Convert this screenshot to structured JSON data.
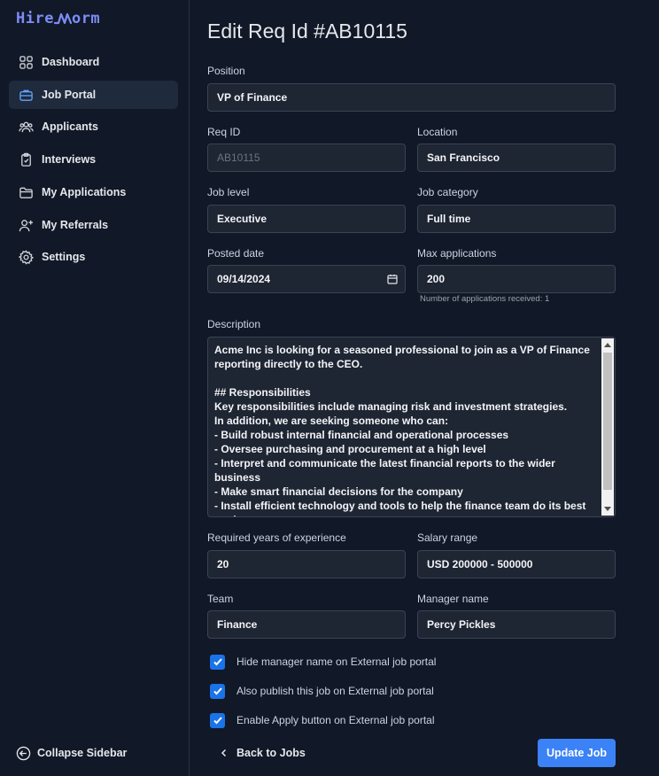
{
  "app": {
    "logo_text_left": "Hire",
    "logo_text_right": "orm",
    "accent_color": "#3b82f6",
    "logo_color": "#7c8cf8"
  },
  "sidebar": {
    "items": [
      {
        "label": "Dashboard",
        "icon": "grid-icon"
      },
      {
        "label": "Job Portal",
        "icon": "briefcase-icon",
        "active": true
      },
      {
        "label": "Applicants",
        "icon": "users-icon"
      },
      {
        "label": "Interviews",
        "icon": "clipboard-icon"
      },
      {
        "label": "My Applications",
        "icon": "folder-icon"
      },
      {
        "label": "My Referrals",
        "icon": "user-plus-icon"
      },
      {
        "label": "Settings",
        "icon": "gear-icon"
      }
    ],
    "collapse_label": "Collapse Sidebar"
  },
  "form": {
    "title": "Edit Req Id #AB10115",
    "position": {
      "label": "Position",
      "value": "VP of Finance"
    },
    "req_id": {
      "label": "Req ID",
      "value": "AB10115"
    },
    "location": {
      "label": "Location",
      "value": "San Francisco"
    },
    "job_level": {
      "label": "Job level",
      "value": "Executive"
    },
    "job_category": {
      "label": "Job category",
      "value": "Full time"
    },
    "posted_date": {
      "label": "Posted date",
      "value": "09/14/2024"
    },
    "max_applications": {
      "label": "Max applications",
      "value": "200",
      "hint": "Number of applications received: 1"
    },
    "description": {
      "label": "Description",
      "value": "Acme Inc is looking for a seasoned professional to join as a VP of Finance reporting directly to the CEO.\n\n## Responsibilities\nKey responsibilities include managing risk and investment strategies.\nIn addition, we are seeking someone who can:\n- Build robust internal financial and operational processes\n- Oversee purchasing and procurement at a high level\n- Interpret and communicate the latest financial reports to the wider business\n- Make smart financial decisions for the company\n- Install efficient technology and tools to help the finance team do its best work\n- Build a successful, high-functioning finance team"
    },
    "years_experience": {
      "label": "Required years of experience",
      "value": "20"
    },
    "salary_range": {
      "label": "Salary range",
      "value": "USD 200000 - 500000"
    },
    "team": {
      "label": "Team",
      "value": "Finance"
    },
    "manager_name": {
      "label": "Manager name",
      "value": "Percy Pickles"
    },
    "checkboxes": [
      {
        "label": "Hide manager name on External job portal",
        "checked": true
      },
      {
        "label": "Also publish this job on External job portal",
        "checked": true
      },
      {
        "label": "Enable Apply button on External job portal",
        "checked": true
      }
    ],
    "back_label": "Back to Jobs",
    "submit_label": "Update Job"
  }
}
